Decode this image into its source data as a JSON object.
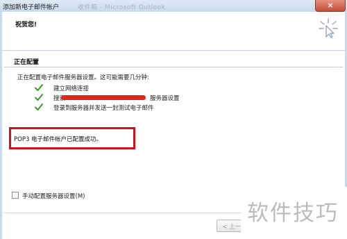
{
  "window": {
    "title": "添加新电子邮件帐户",
    "ghost_title": "收件箱 - Microsoft Outlook",
    "close_glyph": "×"
  },
  "header": {
    "title": "祝贺您!"
  },
  "section": {
    "title": "正在配置",
    "intro": "正在配置电子邮件服务器设置。这可能需要几分钟:"
  },
  "steps": [
    {
      "label": "建立网络连接"
    },
    {
      "label": "搜索",
      "suffix": "服务器设置"
    },
    {
      "label": "登录到服务器并发送一封测试电子邮件"
    }
  ],
  "success": {
    "message": "POP3 电子邮件帐户已配置成功。"
  },
  "manual": {
    "label": "手动配置服务器设置(M)",
    "checked": false
  },
  "buttons": {
    "back": "< 上一步"
  },
  "watermark": "软件技巧",
  "colors": {
    "check": "#3a9a2c",
    "highlight_border": "#d0131b",
    "redaction": "#e0261f"
  }
}
